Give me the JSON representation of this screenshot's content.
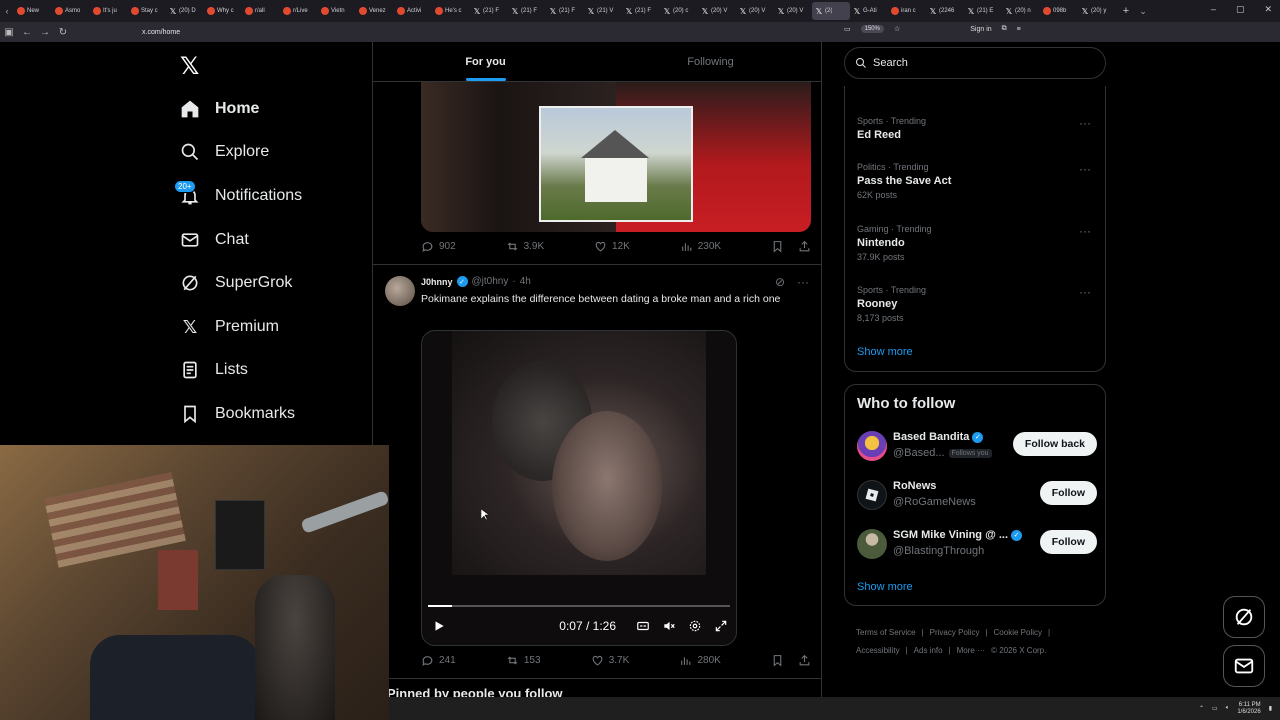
{
  "browser": {
    "tabs": [
      "New",
      "Asmo",
      "It's ju",
      "Stay c",
      "(20) D",
      "Why c",
      "r/all",
      "r/Live",
      "Vietn",
      "Venez",
      "Activi",
      "He's c",
      "(21) F",
      "(21) F",
      "(21) F",
      "(21) V",
      "(21) F",
      "(20) c",
      "(20) V",
      "(20) V",
      "(20) V",
      "(2(",
      "G-Ati",
      "iran c",
      "(2246",
      "(21) E",
      "(20) n",
      "098b",
      "(20) y"
    ],
    "url": "x.com/home",
    "zoom": "150%",
    "sign_in": "Sign in"
  },
  "nav": {
    "home": "Home",
    "explore": "Explore",
    "notifications": "Notifications",
    "notif_badge": "20+",
    "chat": "Chat",
    "supergrok": "SuperGrok",
    "premium": "Premium",
    "lists": "Lists",
    "bookmarks": "Bookmarks"
  },
  "timeline": {
    "tabs": [
      "For you",
      "Following"
    ],
    "post1": {
      "replies": "902",
      "reposts": "3.9K",
      "likes": "12K",
      "views": "230K"
    },
    "post2": {
      "author": "J0hnny",
      "handle": "@jt0hny",
      "time": "4h",
      "text": "Pokimane explains the difference between dating a broke man and a rich one",
      "video_time": "0:07 / 1:26",
      "video_progress": 0.08,
      "replies": "241",
      "reposts": "153",
      "likes": "3.7K",
      "views": "280K"
    },
    "pinned_heading": "Pinned by people you follow"
  },
  "sidebar": {
    "search_placeholder": "Search",
    "trends": [
      {
        "category": "Sports · Trending",
        "name": "Ed Reed",
        "posts": ""
      },
      {
        "category": "Politics · Trending",
        "name": "Pass the Save Act",
        "posts": "62K posts"
      },
      {
        "category": "Gaming · Trending",
        "name": "Nintendo",
        "posts": "37.9K posts"
      },
      {
        "category": "Sports · Trending",
        "name": "Rooney",
        "posts": "8,173 posts"
      }
    ],
    "show_more": "Show more",
    "who_to_follow": {
      "title": "Who to follow",
      "accounts": [
        {
          "name": "Based Bandita",
          "handle": "@Based...",
          "follows_you": "Follows you",
          "button": "Follow back"
        },
        {
          "name": "RoNews",
          "handle": "@RoGameNews",
          "button": "Follow"
        },
        {
          "name": "SGM Mike Vining @ ...",
          "handle": "@BlastingThrough",
          "button": "Follow"
        }
      ],
      "show_more": "Show more"
    },
    "footer": [
      "Terms of Service",
      "|",
      "Privacy Policy",
      "|",
      "Cookie Policy",
      "|",
      "Accessibility",
      "|",
      "Ads info",
      "|",
      "More ···",
      "© 2026 X Corp."
    ]
  },
  "taskbar": {
    "time": "6:11 PM",
    "date": "1/6/2026"
  }
}
